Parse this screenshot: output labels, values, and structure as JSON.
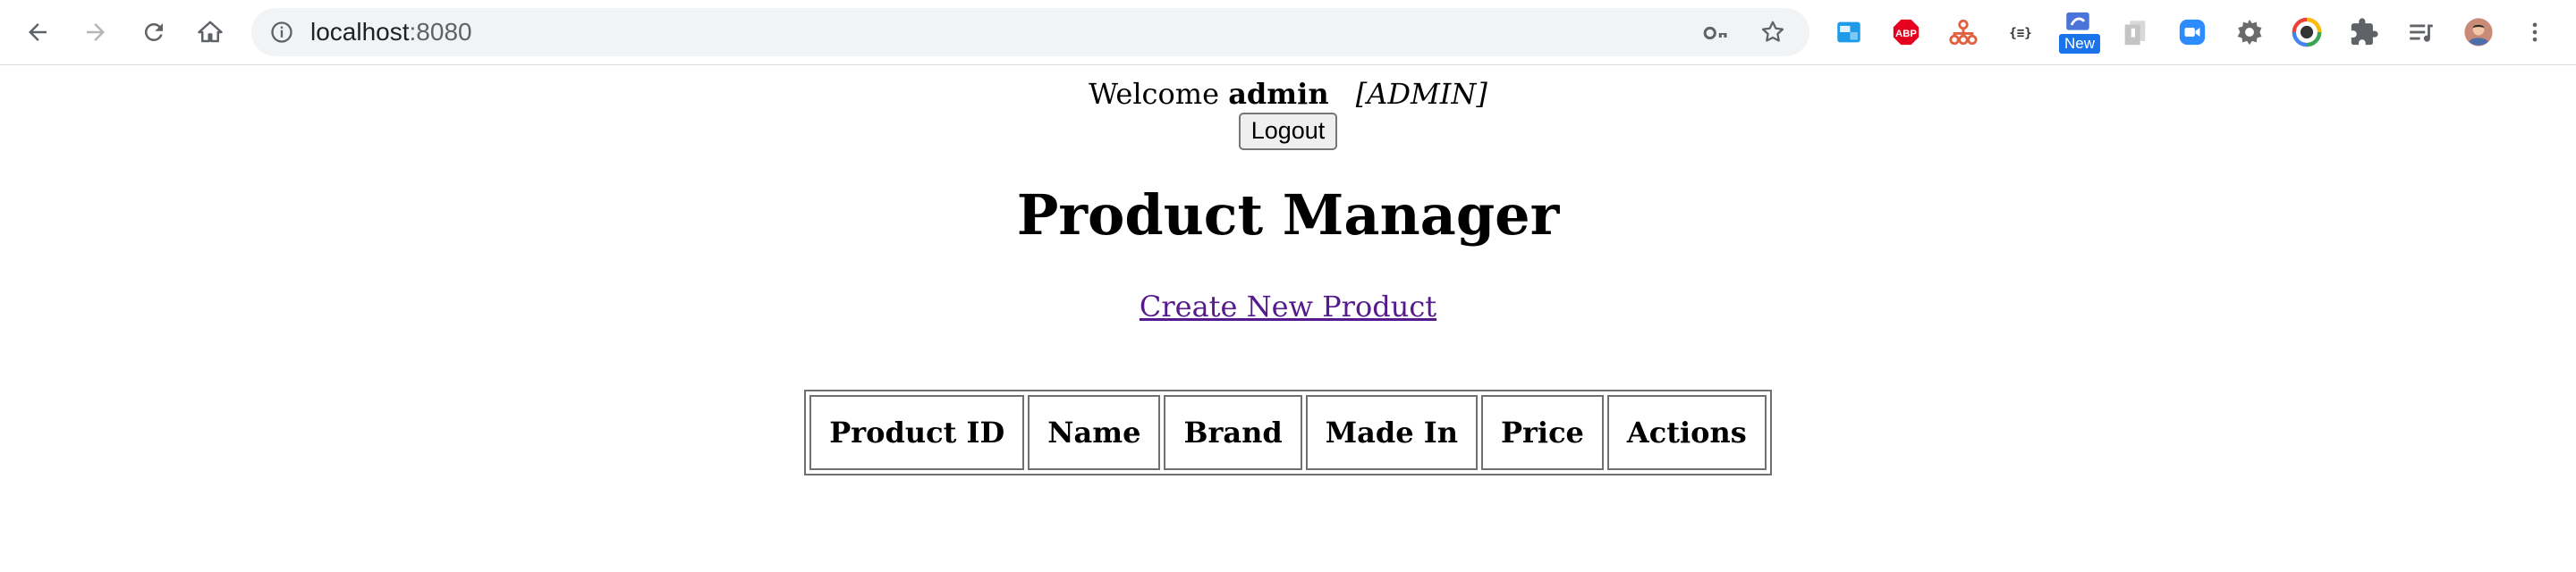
{
  "browser": {
    "url_host": "localhost",
    "url_port": ":8080",
    "extension_badge": "New",
    "extensions": [
      "image-extension-icon",
      "adblock-plus-icon",
      "org-chart-icon",
      "json-viewer-icon",
      "new-extension-icon",
      "document-extension-icon",
      "zoom-icon",
      "gear-extension-icon",
      "color-picker-icon",
      "extensions-puzzle-icon",
      "reading-list-icon"
    ]
  },
  "header": {
    "welcome_prefix": "Welcome",
    "username": "admin",
    "role": "[ADMIN]",
    "logout_label": "Logout"
  },
  "main": {
    "title": "Product Manager",
    "create_link": "Create New Product",
    "table": {
      "columns": [
        "Product ID",
        "Name",
        "Brand",
        "Made In",
        "Price",
        "Actions"
      ],
      "rows": []
    }
  },
  "colors": {
    "link_visited": "#551a8b",
    "omnibox_bg": "#f1f3f4",
    "badge_blue": "#1a73e8"
  }
}
